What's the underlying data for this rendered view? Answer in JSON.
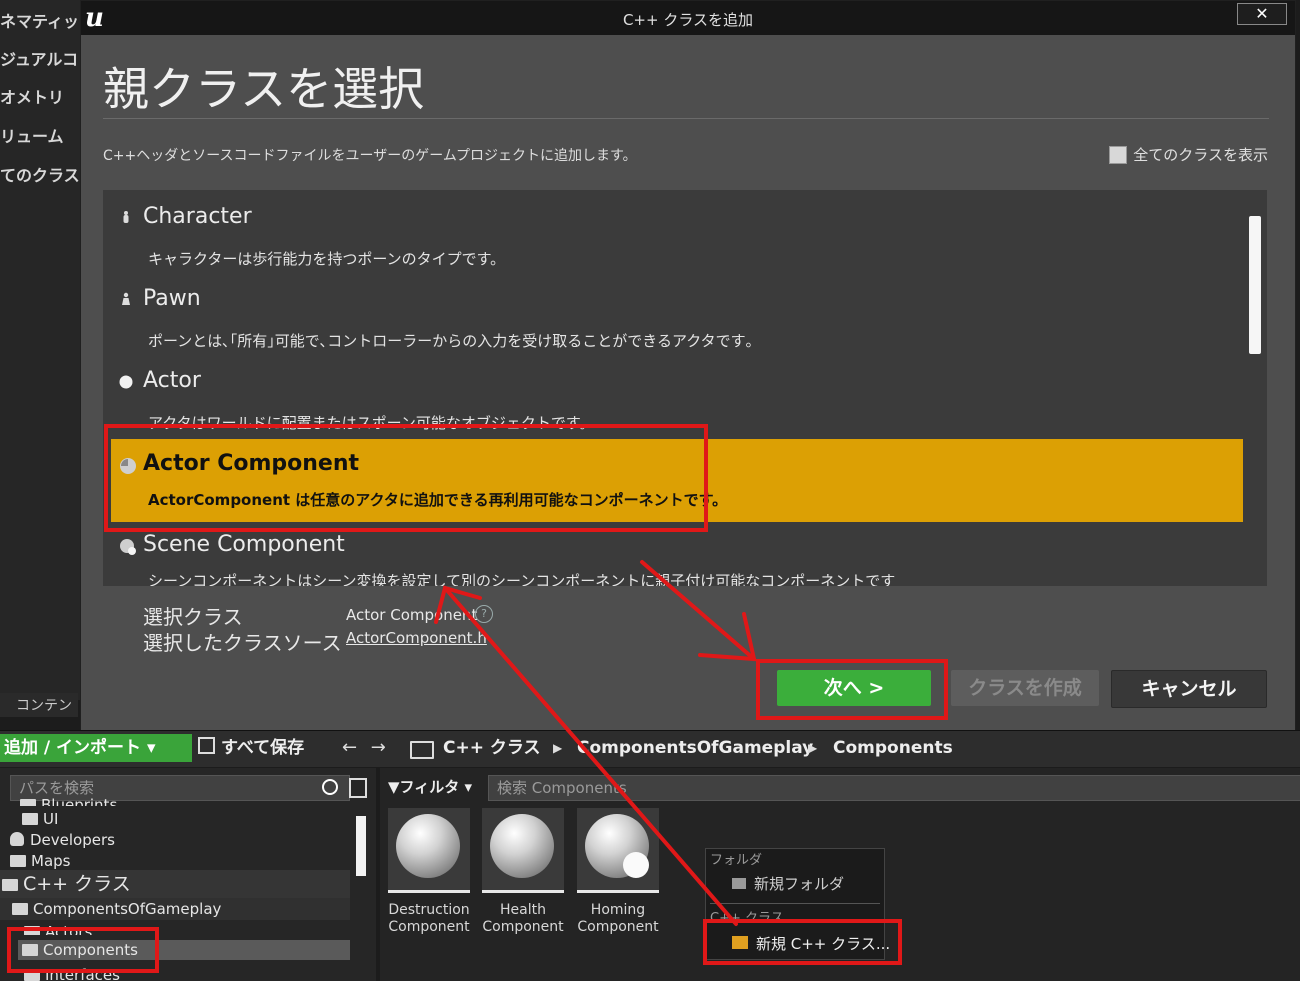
{
  "background_left_panel": {
    "items": [
      "ネマティッ",
      "ジュアルコ",
      "オメトリ",
      "リューム",
      "てのクラス"
    ]
  },
  "dialog": {
    "window_title": "C++ クラスを追加",
    "close_label": "✕",
    "heading": "親クラスを選択",
    "description": "C++ヘッダとソースコードファイルをユーザーのゲームプロジェクトに追加します。",
    "show_all_label": "全てのクラスを表示",
    "classes": [
      {
        "name": "Character",
        "description": "キャラクターは歩行能力を持つポーンのタイプです。",
        "icon": "character-icon"
      },
      {
        "name": "Pawn",
        "description": "ポーンとは､｢所有｣可能で､コントローラーからの入力を受け取ることができるアクタです｡",
        "icon": "pawn-icon"
      },
      {
        "name": "Actor",
        "description": "アクタはワールドに配置またはスポーン可能なオブジェクトです。",
        "icon": "actor-icon"
      },
      {
        "name": "Actor Component",
        "description": "ActorComponent は任意のアクタに追加できる再利用可能なコンポーネントです。",
        "icon": "actor-component-icon",
        "selected": true
      },
      {
        "name": "Scene Component",
        "description": "シーンコンポーネントはシーン変換を設定して別のシーンコンポーネントに親子付け可能なコンポーネントです",
        "icon": "scene-component-icon"
      }
    ],
    "selected_class_label": "選択クラス",
    "selected_class_value": "Actor Component",
    "selected_source_label": "選択したクラスソース",
    "selected_source_value": "ActorComponent.h",
    "buttons": {
      "next": "次へ >",
      "create": "クラスを作成",
      "cancel": "キャンセル"
    },
    "selection_color": "#dca004",
    "next_color": "#3bae3b"
  },
  "content_browser": {
    "tab_label": "コンテン",
    "add_import_label": "追加 / インポート ▾",
    "save_all_label": "すべて保存",
    "nav_arrows": "← →",
    "breadcrumbs": [
      "C++ クラス",
      "ComponentsOfGameplay",
      "Components"
    ],
    "path_search_placeholder": "パスを検索",
    "filter_label": "フィルタ ▾",
    "content_search_placeholder": "検索 Components",
    "tree": [
      {
        "label": "Blueprints"
      },
      {
        "label": "UI"
      },
      {
        "label": "Developers"
      },
      {
        "label": "Maps"
      },
      {
        "label": "C++ クラス"
      },
      {
        "label": "ComponentsOfGameplay"
      },
      {
        "label": "Actors"
      },
      {
        "label": "Components",
        "selected": true
      },
      {
        "label": "Interfaces"
      }
    ],
    "assets": [
      {
        "line1": "Destruction",
        "line2": "Component"
      },
      {
        "line1": "Health",
        "line2": "Component"
      },
      {
        "line1": "Homing",
        "line2": "Component"
      }
    ],
    "context_menu": {
      "folder_header": "フォルダ",
      "new_folder": "新規フォルダ",
      "cpp_header": "C++ クラス",
      "new_cpp_class": "新規 C++ クラス..."
    }
  },
  "annotation_color": "#e01818"
}
